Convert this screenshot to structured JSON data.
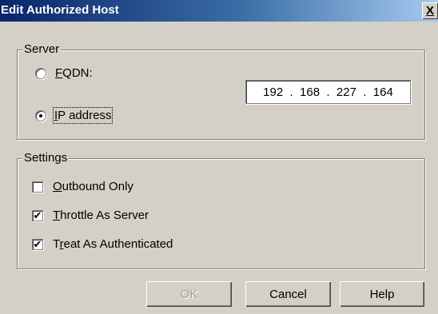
{
  "window": {
    "title": "Edit Authorized Host",
    "close_glyph": "X"
  },
  "server": {
    "legend": "Server",
    "fqdn": {
      "label": "FQDN:",
      "selected": false
    },
    "ip": {
      "label": "IP address",
      "selected": true,
      "octets": [
        "192",
        "168",
        "227",
        "164"
      ]
    }
  },
  "settings": {
    "legend": "Settings",
    "outbound_only": {
      "label": "Outbound Only",
      "checked": false
    },
    "throttle_as_server": {
      "label": "Throttle As Server",
      "checked": true
    },
    "treat_as_authenticated": {
      "label": "Treat As Authenticated",
      "checked": true
    }
  },
  "buttons": {
    "ok": "OK",
    "cancel": "Cancel",
    "help": "Help"
  },
  "colors": {
    "dialog_bg": "#d4d0c8",
    "title_start": "#0a246a",
    "title_end": "#a6caf0"
  }
}
